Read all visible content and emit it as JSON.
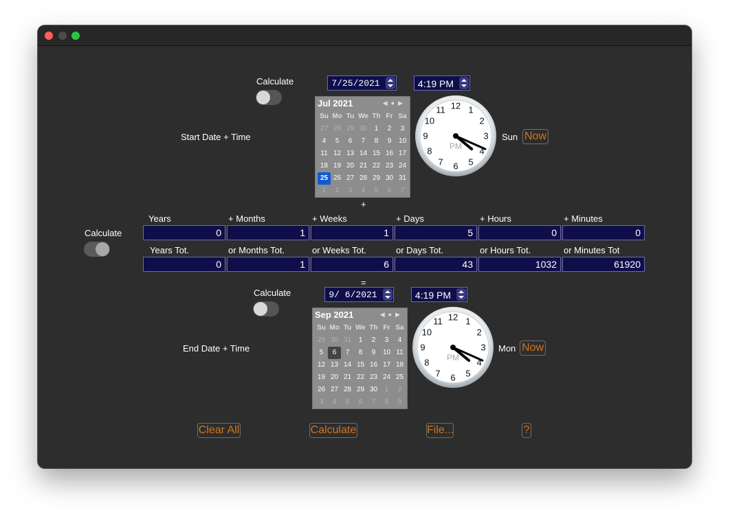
{
  "start": {
    "calc_label": "Calculate",
    "title": "Start Date + Time",
    "date": "7/25/2021",
    "time": "4:19 PM",
    "day": "Sun",
    "now": "Now",
    "calendar": {
      "header": "Jul 2021",
      "dow": [
        "Su",
        "Mo",
        "Tu",
        "We",
        "Th",
        "Fr",
        "Sa"
      ],
      "days": [
        [
          "27",
          "28",
          "29",
          "30",
          "1",
          "2",
          "3"
        ],
        [
          "4",
          "5",
          "6",
          "7",
          "8",
          "9",
          "10"
        ],
        [
          "11",
          "12",
          "13",
          "14",
          "15",
          "16",
          "17"
        ],
        [
          "18",
          "19",
          "20",
          "21",
          "22",
          "23",
          "24"
        ],
        [
          "25",
          "26",
          "27",
          "28",
          "29",
          "30",
          "31"
        ],
        [
          "1",
          "2",
          "3",
          "4",
          "5",
          "6",
          "7"
        ]
      ]
    },
    "clock": {
      "ampm": "PM",
      "hour": 4,
      "minute": 19
    }
  },
  "plus": "+",
  "equals": "=",
  "duration": {
    "calc_label": "Calculate",
    "headers": [
      "Years",
      "+ Months",
      "+ Weeks",
      "+ Days",
      "+ Hours",
      "+ Minutes"
    ],
    "values": [
      "0",
      "1",
      "1",
      "5",
      "0",
      "0"
    ],
    "tot_headers": [
      "Years Tot.",
      "or Months Tot.",
      "or Weeks Tot.",
      "or Days Tot.",
      "or Hours Tot.",
      "or Minutes Tot"
    ],
    "tot_values": [
      "0",
      "1",
      "6",
      "43",
      "1032",
      "61920"
    ]
  },
  "end": {
    "calc_label": "Calculate",
    "title": "End Date + Time",
    "date": "9/ 6/2021",
    "time": "4:19 PM",
    "day": "Mon",
    "now": "Now",
    "calendar": {
      "header": "Sep 2021",
      "dow": [
        "Su",
        "Mo",
        "Tu",
        "We",
        "Th",
        "Fr",
        "Sa"
      ],
      "days": [
        [
          "29",
          "30",
          "31",
          "1",
          "2",
          "3",
          "4"
        ],
        [
          "5",
          "6",
          "7",
          "8",
          "9",
          "10",
          "11"
        ],
        [
          "12",
          "13",
          "14",
          "15",
          "16",
          "17",
          "18"
        ],
        [
          "19",
          "20",
          "21",
          "22",
          "23",
          "24",
          "25"
        ],
        [
          "26",
          "27",
          "28",
          "29",
          "30",
          "1",
          "2"
        ],
        [
          "3",
          "4",
          "5",
          "6",
          "7",
          "8",
          "9"
        ]
      ]
    },
    "clock": {
      "ampm": "PM",
      "hour": 4,
      "minute": 19
    }
  },
  "buttons": {
    "clear_all": "Clear All",
    "calculate": "Calculate",
    "file": "File...",
    "help": "?"
  },
  "clock_numbers": [
    "12",
    "1",
    "2",
    "3",
    "4",
    "5",
    "6",
    "7",
    "8",
    "9",
    "10",
    "11"
  ],
  "colors": {
    "accent": "#d2761c",
    "field_bg": "#0e0f4a",
    "selected_day": "#0f5bd6"
  }
}
